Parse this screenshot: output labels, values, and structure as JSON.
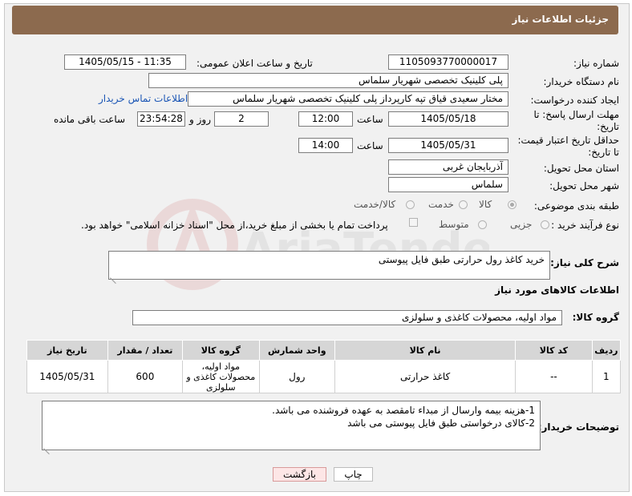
{
  "header": {
    "title": "جزئیات اطلاعات نیاز"
  },
  "fields": {
    "need_number_label": "شماره نیاز:",
    "need_number": "1105093770000017",
    "announce_datetime_label": "تاریخ و ساعت اعلان عمومی:",
    "announce_datetime": "1405/05/15 - 11:35",
    "buyer_org_label": "نام دستگاه خریدار:",
    "buyer_org": "پلی کلینیک تخصصی شهریار سلماس",
    "requester_label": "ایجاد کننده درخواست:",
    "requester": "مختار سعیدی قیاق تپه کارپرداز پلی کلینیک تخصصی شهریار سلماس",
    "buyer_contact_link": "اطلاعات تماس خریدار",
    "reply_deadline_label_1": "مهلت ارسال پاسخ: تا",
    "reply_deadline_label_2": "تاریخ:",
    "reply_date": "1405/05/18",
    "time_label": "ساعت",
    "reply_time": "12:00",
    "days_value": "2",
    "days_label": "روز و",
    "remaining_time": "23:54:28",
    "remaining_label": "ساعت باقی مانده",
    "price_validity_label_1": "حداقل تاریخ اعتبار قیمت:",
    "price_validity_label_2": "تا تاریخ:",
    "price_date": "1405/05/31",
    "price_time_label": "ساعت",
    "price_time": "14:00",
    "province_label": "استان محل تحویل:",
    "province": "آذربایجان غربی",
    "city_label": "شهر محل تحویل:",
    "city": "سلماس",
    "category_label": "طبقه بندی موضوعی:",
    "category_options": [
      "کالا",
      "خدمت",
      "کالا/خدمت"
    ],
    "category_selected": "کالا",
    "purchase_type_label": "نوع فرآیند خرید :",
    "purchase_options": [
      "جزیی",
      "متوسط"
    ],
    "payment_note": "پرداخت تمام یا بخشی از مبلغ خرید،از محل \"اسناد خزانه اسلامی\" خواهد بود."
  },
  "description": {
    "label": "شرح کلی نیاز:",
    "text": "خرید کاغذ رول حرارتی طبق فایل پیوستی"
  },
  "goods": {
    "section_title": "اطلاعات کالاهای مورد نیاز",
    "group_label": "گروه کالا:",
    "group_value": "مواد اولیه، محصولات کاغذی و سلولزی",
    "columns": [
      "ردیف",
      "کد کالا",
      "نام کالا",
      "واحد شمارش",
      "گروه کالا",
      "تعداد / مقدار",
      "تاریخ نیاز"
    ],
    "rows": [
      {
        "row": "1",
        "code": "--",
        "name": "کاغذ حرارتی",
        "unit": "رول",
        "group": "مواد اولیه، محصولات کاغذی و سلولزی",
        "qty": "600",
        "date": "1405/05/31"
      }
    ]
  },
  "buyer_notes": {
    "label": "توضیحات خریدار:",
    "line1": "1-هزینه بیمه وارسال از مبداء تامقصد به عهده فروشنده می باشد.",
    "line2": "2-کالای درخواستی طبق فایل پیوستی می باشد"
  },
  "buttons": {
    "print": "چاپ",
    "back": "بازگشت"
  },
  "watermark": {
    "text": "AriaTender.net"
  },
  "colors": {
    "header_bg": "#8c6a4e",
    "link": "#1a55b5",
    "back_bg": "#fde6e6"
  }
}
